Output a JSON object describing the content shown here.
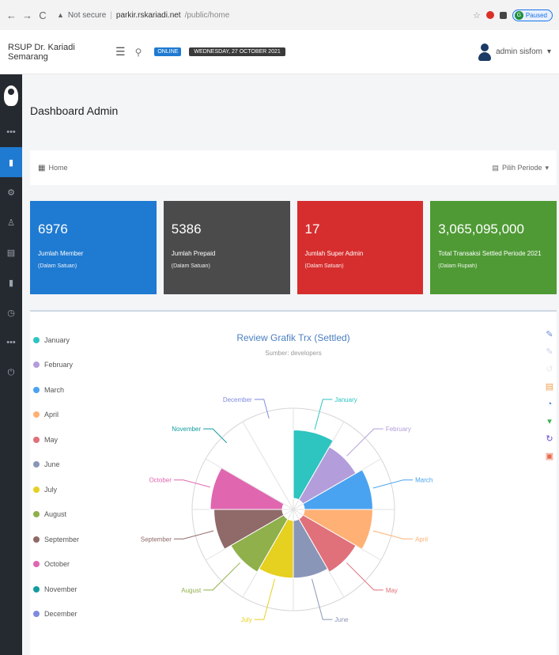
{
  "browser": {
    "nav": [
      "←",
      "→",
      "C"
    ],
    "security_text": "Not secure",
    "url_host": "parkir.rskariadi.net",
    "url_path": "/public/home",
    "paused_label": "Paused"
  },
  "header": {
    "brand": "RSUP Dr. Kariadi Semarang",
    "online_label": "ONLINE",
    "date_label": "WEDNESDAY, 27 OCTOBER 2021",
    "user_name": "admin sisfom",
    "user_caret": "▾"
  },
  "sidebar": {
    "items": [
      {
        "icon": "dots-icon",
        "glyph": "•••"
      },
      {
        "icon": "briefcase-icon",
        "glyph": "▮"
      },
      {
        "icon": "settings-icon",
        "glyph": "⚙"
      },
      {
        "icon": "person-icon",
        "glyph": "♙"
      },
      {
        "icon": "document-icon",
        "glyph": "▤"
      },
      {
        "icon": "file-icon",
        "glyph": "▮"
      },
      {
        "icon": "clock-icon",
        "glyph": "◷"
      },
      {
        "icon": "dots-icon",
        "glyph": "•••"
      },
      {
        "icon": "power-icon",
        "glyph": "⏻"
      }
    ]
  },
  "page": {
    "title": "Dashboard Admin",
    "breadcrumb_home": "Home",
    "period_label": "Pilih Periode",
    "period_caret": "▾"
  },
  "cards": [
    {
      "value": "6976",
      "label": "Jumlah Member",
      "unit": "(Dalam Satuan)",
      "color": "#1f7ad1"
    },
    {
      "value": "5386",
      "label": "Jumlah Prepaid",
      "unit": "(Dalam Satuan)",
      "color": "#4b4b4b"
    },
    {
      "value": "17",
      "label": "Jumlah Super Admin",
      "unit": "(Dalam Satuan)",
      "color": "#d62e2e"
    },
    {
      "value": "3,065,095,000",
      "label": "Total Transaksi Settled Periode 2021",
      "unit": "(Dalam Rupiah)",
      "color": "#4f9a35"
    }
  ],
  "chart_data": {
    "type": "pie",
    "subtype": "nightingale-rose",
    "title": "Review Grafik Trx (Settled)",
    "subtitle": "Sumber: developers",
    "categories": [
      "January",
      "February",
      "March",
      "April",
      "May",
      "June",
      "July",
      "August",
      "September",
      "October",
      "November",
      "December"
    ],
    "values": [
      95,
      85,
      95,
      95,
      85,
      80,
      80,
      85,
      95,
      100,
      0,
      0
    ],
    "colors": [
      "#2ec4c0",
      "#b39ddb",
      "#4aa3f0",
      "#ffb074",
      "#e0707a",
      "#8a96b8",
      "#e6d020",
      "#8fb04a",
      "#8f6a68",
      "#e066b0",
      "#139ca0",
      "#7e8be0"
    ],
    "legend_placement": "left"
  },
  "toolbox": [
    {
      "icon": "pencil-icon",
      "glyph": "✎",
      "color": "#6a8ad6"
    },
    {
      "icon": "pencil-light-icon",
      "glyph": "✎",
      "color": "#c8d2ec"
    },
    {
      "icon": "undo-icon",
      "glyph": "↺",
      "color": "#e8e8e8"
    },
    {
      "icon": "data-view-icon",
      "glyph": "▤",
      "color": "#f0a050"
    },
    {
      "icon": "pie-icon",
      "glyph": "◔",
      "color": "#3b7be8"
    },
    {
      "icon": "filter-icon",
      "glyph": "▾",
      "color": "#35b050"
    },
    {
      "icon": "refresh-icon",
      "glyph": "↻",
      "color": "#6a4ad6"
    },
    {
      "icon": "save-image-icon",
      "glyph": "▣",
      "color": "#e86a4a"
    }
  ]
}
